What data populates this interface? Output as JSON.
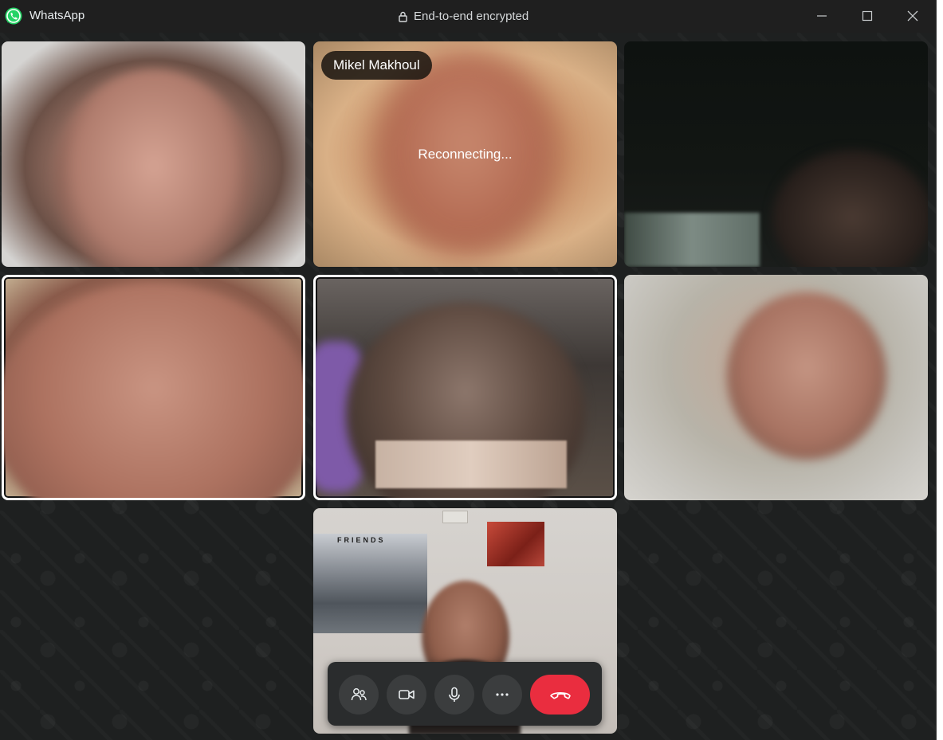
{
  "window": {
    "app_title": "WhatsApp",
    "encryption_label": "End-to-end encrypted",
    "brand_color": "#25d366"
  },
  "window_controls": {
    "minimize_icon": "minimize-icon",
    "maximize_icon": "maximize-icon",
    "close_icon": "close-icon"
  },
  "participants": [
    {
      "slot": 1,
      "name": "",
      "status": "",
      "selected": false
    },
    {
      "slot": 2,
      "name": "Mikel Makhoul",
      "status": "Reconnecting...",
      "selected": false
    },
    {
      "slot": 3,
      "name": "",
      "status": "",
      "selected": false
    },
    {
      "slot": 4,
      "name": "",
      "status": "",
      "selected": true
    },
    {
      "slot": 5,
      "name": "",
      "status": "",
      "selected": true
    },
    {
      "slot": 6,
      "name": "",
      "status": "",
      "selected": false
    },
    {
      "slot": 7,
      "name": "",
      "status": "",
      "selected": false
    }
  ],
  "self_view_poster_text": "FRIENDS",
  "controls": {
    "participants_icon": "people-icon",
    "video_icon": "video-camera-icon",
    "mic_icon": "microphone-icon",
    "more_icon": "more-horizontal-icon",
    "end_call_icon": "phone-hangup-icon",
    "end_call_color": "#ea2d3f"
  }
}
